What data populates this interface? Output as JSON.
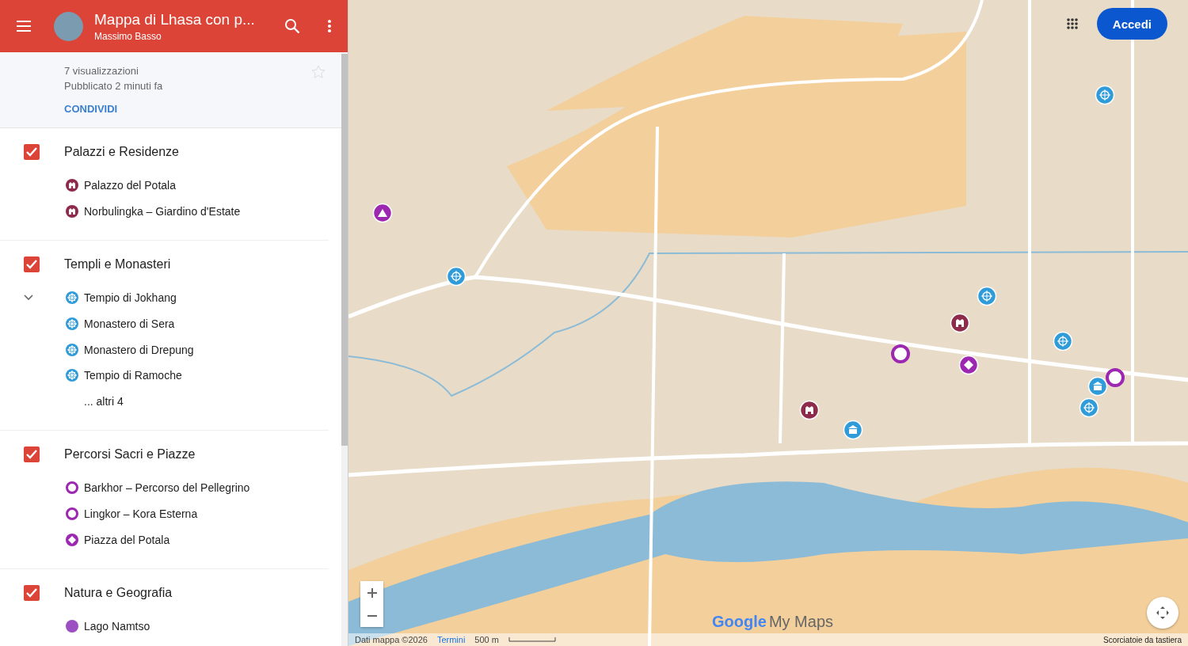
{
  "header": {
    "title": "Mappa di Lhasa con p...",
    "author": "Massimo Basso"
  },
  "info": {
    "views": "7 visualizzazioni",
    "published": "Pubblicato 2 minuti fa",
    "share": "CONDIVIDI",
    "starred": false
  },
  "layers": [
    {
      "name": "Palazzi e Residenze",
      "checked": true,
      "items": [
        {
          "label": "Palazzo del Potala",
          "kind": "palace",
          "color": "#8e2a4a"
        },
        {
          "label": "Norbulingka – Giardino d'Estate",
          "kind": "palace",
          "color": "#8e2a4a"
        }
      ]
    },
    {
      "name": "Templi e Monasteri",
      "checked": true,
      "more": "... altri 4",
      "items": [
        {
          "label": "Tempio di Jokhang",
          "kind": "wheel",
          "color": "#2f9bd9"
        },
        {
          "label": "Monastero di Sera",
          "kind": "wheel",
          "color": "#2f9bd9"
        },
        {
          "label": "Monastero di Drepung",
          "kind": "wheel",
          "color": "#2f9bd9"
        },
        {
          "label": "Tempio di Ramoche",
          "kind": "wheel",
          "color": "#2f9bd9"
        }
      ]
    },
    {
      "name": "Percorsi Sacri e Piazze",
      "checked": true,
      "items": [
        {
          "label": "Barkhor – Percorso del Pellegrino",
          "kind": "ring",
          "color": "#9c27b0"
        },
        {
          "label": "Lingkor – Kora Esterna",
          "kind": "ring",
          "color": "#9c27b0"
        },
        {
          "label": "Piazza del Potala",
          "kind": "diamond",
          "color": "#9c27b0"
        }
      ]
    },
    {
      "name": "Natura e Geografia",
      "checked": true,
      "items": [
        {
          "label": "Lago Namtso",
          "kind": "dot",
          "color": "#9b4fc2"
        }
      ]
    }
  ],
  "map": {
    "signin": "Accedi",
    "logo_google": "Google",
    "logo_suffix": "My Maps",
    "attribution": "Dati mappa ©2026",
    "terms": "Termini",
    "scale": "500 m",
    "shortcuts": "Scorciatoie da tastiera"
  }
}
